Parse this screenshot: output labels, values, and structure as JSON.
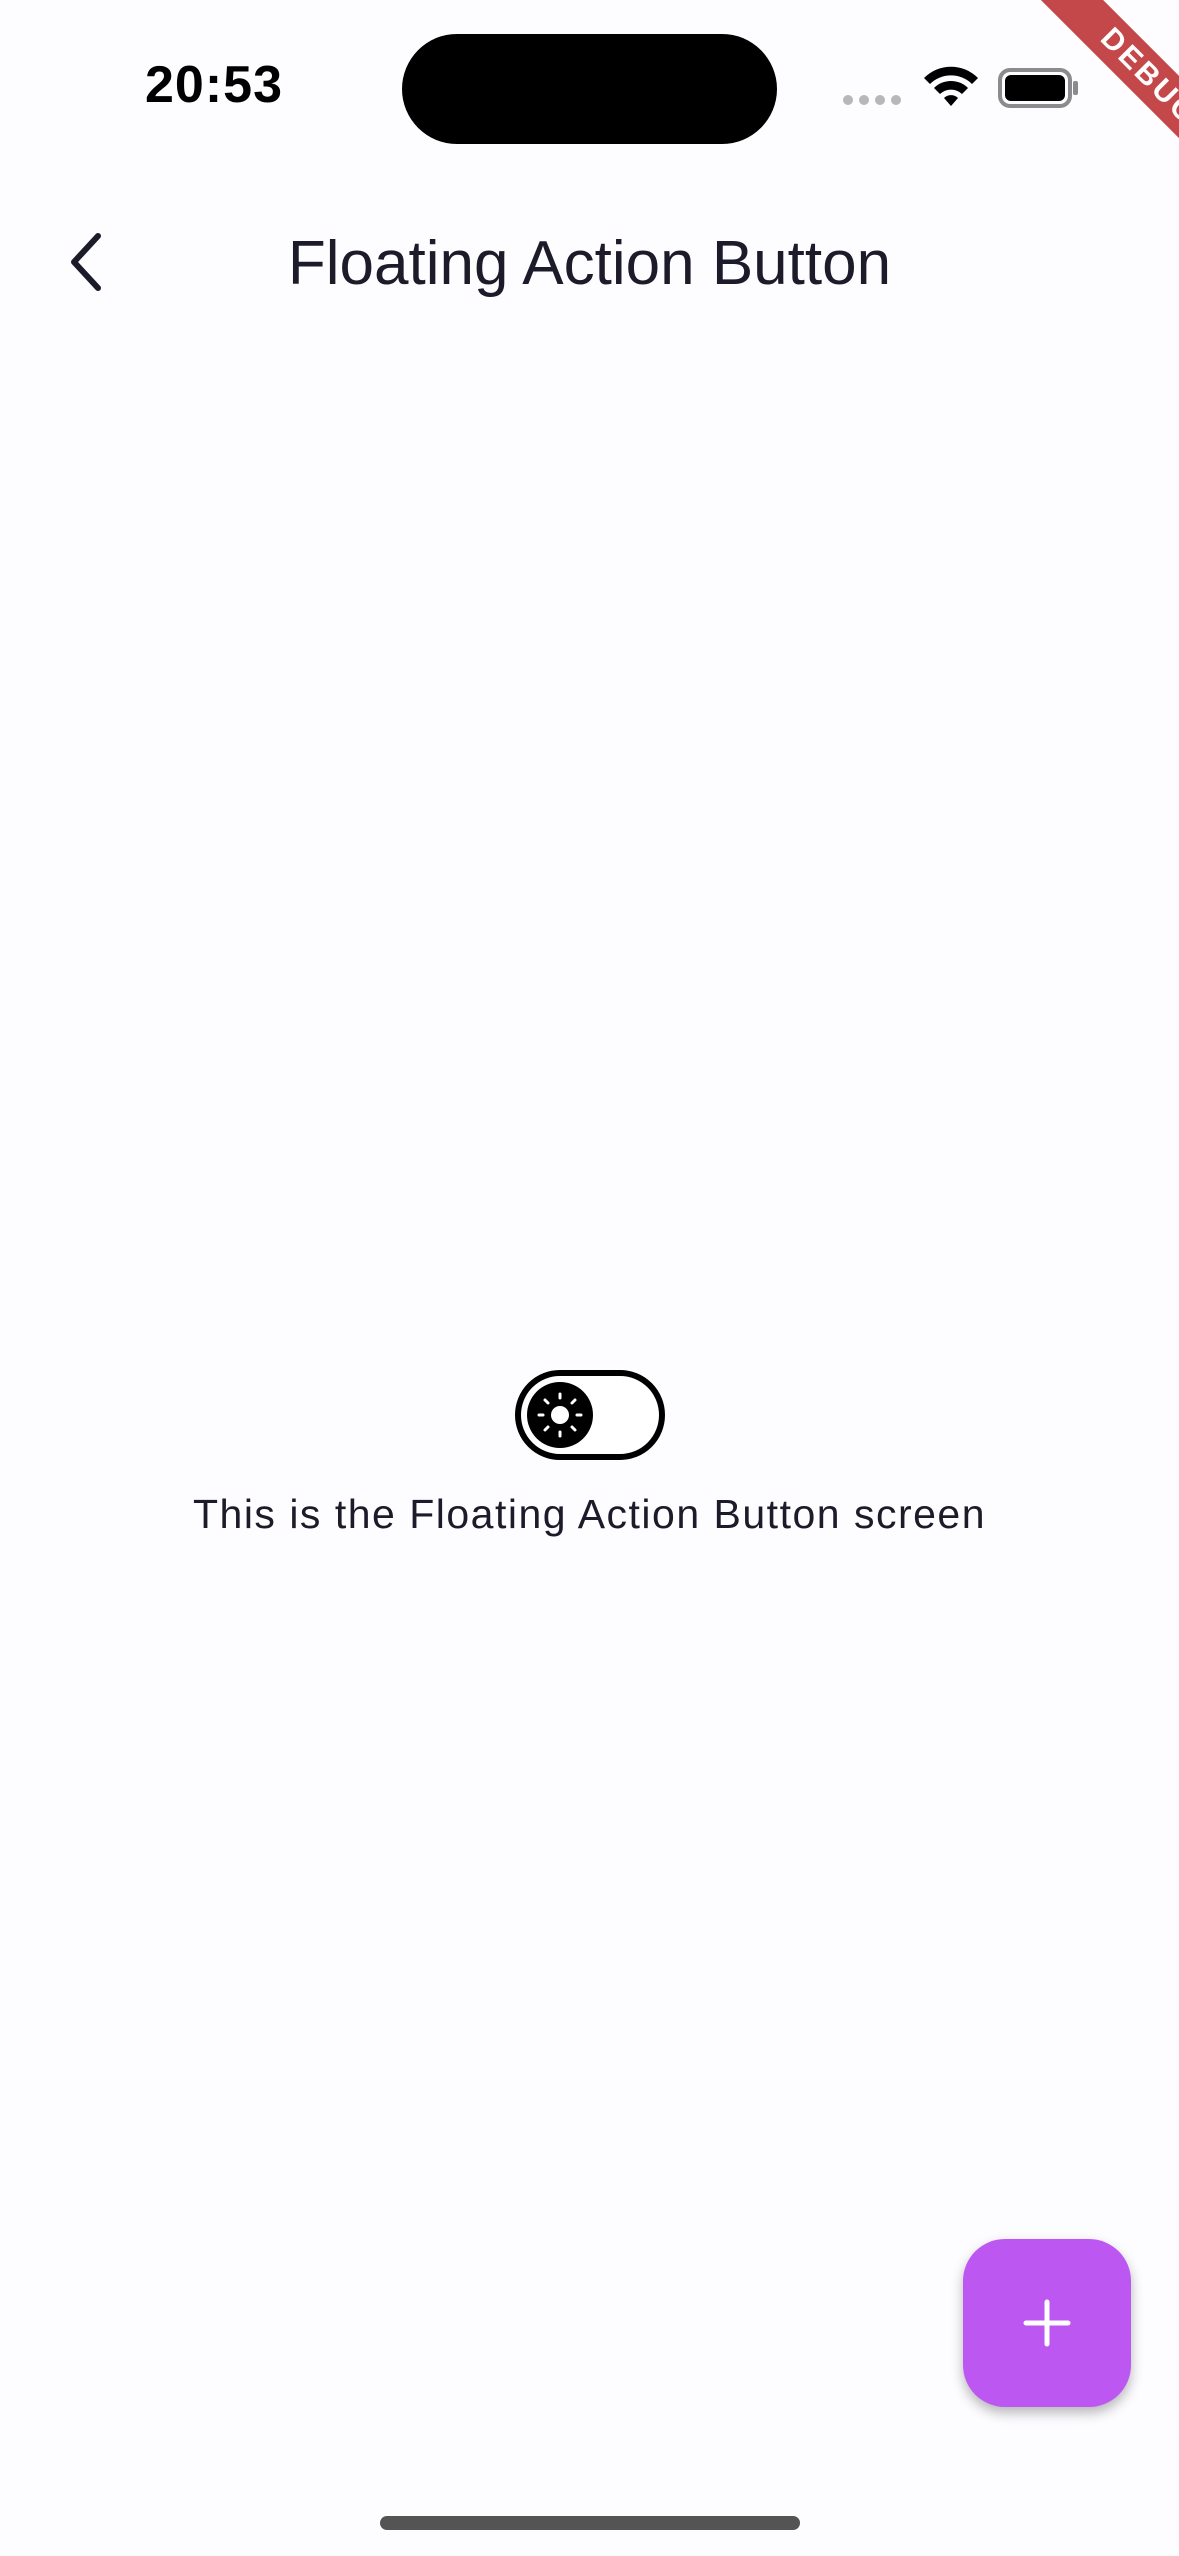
{
  "status_bar": {
    "time": "20:53"
  },
  "debug_banner": {
    "label": "DEBUG",
    "color": "#b71c1c"
  },
  "app_bar": {
    "title": "Floating Action Button",
    "back_icon": "chevron-left-icon"
  },
  "content": {
    "theme_toggle": {
      "icon": "sun-icon",
      "state": "light"
    },
    "message": "This is the Floating Action Button screen"
  },
  "fab": {
    "icon": "plus-icon",
    "color": "#bd57f2"
  }
}
